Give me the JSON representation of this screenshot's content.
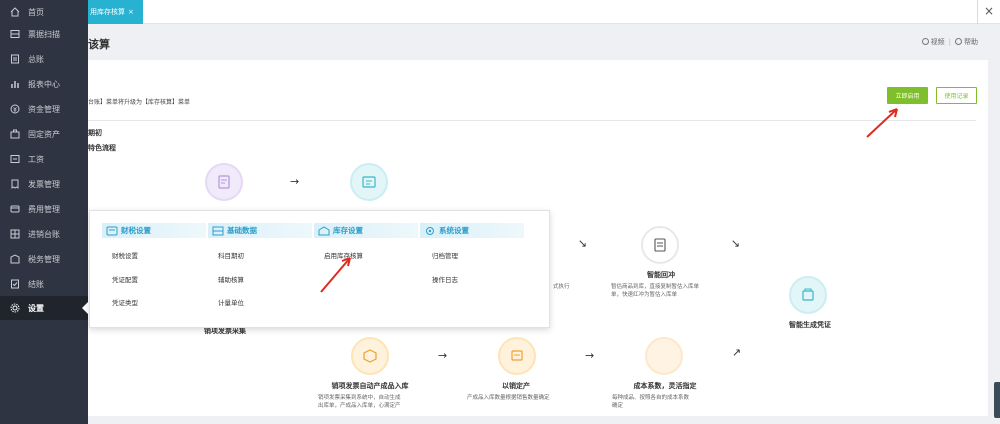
{
  "sidebar": {
    "items": [
      {
        "label": "首页",
        "icon": "home-icon"
      },
      {
        "label": "票据扫描",
        "icon": "scan-icon"
      },
      {
        "label": "总账",
        "icon": "ledger-icon"
      },
      {
        "label": "报表中心",
        "icon": "report-icon"
      },
      {
        "label": "资金管理",
        "icon": "money-icon"
      },
      {
        "label": "固定资产",
        "icon": "asset-icon"
      },
      {
        "label": "工资",
        "icon": "salary-icon"
      },
      {
        "label": "发票管理",
        "icon": "invoice-icon"
      },
      {
        "label": "费用管理",
        "icon": "expense-icon"
      },
      {
        "label": "进销台账",
        "icon": "stock-ledger-icon"
      },
      {
        "label": "税务管理",
        "icon": "tax-icon"
      },
      {
        "label": "结账",
        "icon": "close-books-icon"
      },
      {
        "label": "设置",
        "icon": "gear-icon",
        "active": true
      }
    ]
  },
  "topbar": {
    "tab_label": "用库存核算",
    "tab_close": "×",
    "close_glyph": "×"
  },
  "page": {
    "title": "该算",
    "video_label": "视频",
    "separator": "|",
    "help_label": "帮助"
  },
  "card": {
    "desc": "台账】菜单将升级为【库存核算】菜单",
    "enable_button": "立即启用",
    "record_button": "使用记录",
    "section_a": "期初",
    "section_b": "特色流程"
  },
  "flow": {
    "steps": [
      {
        "title": "智能回冲",
        "desc_lines": [
          "暂估商品到库，直接复制暂估入库单",
          "单，快速红冲为暂估入库单"
        ]
      },
      {
        "title": "智能生成凭证",
        "desc_lines": []
      },
      {
        "title": "销项发票采集",
        "desc_lines": []
      },
      {
        "title": "销项发票自动产成品入库",
        "desc_lines": [
          "销项发票采集到系统中，自动生成",
          "出库单，产成品入库单，心满定产"
        ]
      },
      {
        "title": "以销定产",
        "desc_lines": [
          "产成品入库数量根据销售数量确定"
        ]
      },
      {
        "title": "成本系数，灵活指定",
        "desc_lines": [
          "每种成品、按照各自的成本系数",
          "确定"
        ]
      }
    ],
    "partial_side_text": "式执行"
  },
  "popup": {
    "columns": [
      {
        "header": "财税设置",
        "items": [
          "财税设置",
          "凭证配置",
          "凭证类型"
        ]
      },
      {
        "header": "基础数据",
        "items": [
          "科目期初",
          "辅助核算",
          "计量单位"
        ]
      },
      {
        "header": "库存设置",
        "items": [
          "启用库存核算"
        ]
      },
      {
        "header": "系统设置",
        "items": [
          "归档管理",
          "操作日志"
        ]
      }
    ]
  },
  "colors": {
    "sidebar_bg": "#2e3441",
    "tab_bg": "#27b2d1",
    "accent_green": "#7fbf2b",
    "menu_header_text": "#2d9ecb",
    "arrow_red": "#e02a20"
  }
}
